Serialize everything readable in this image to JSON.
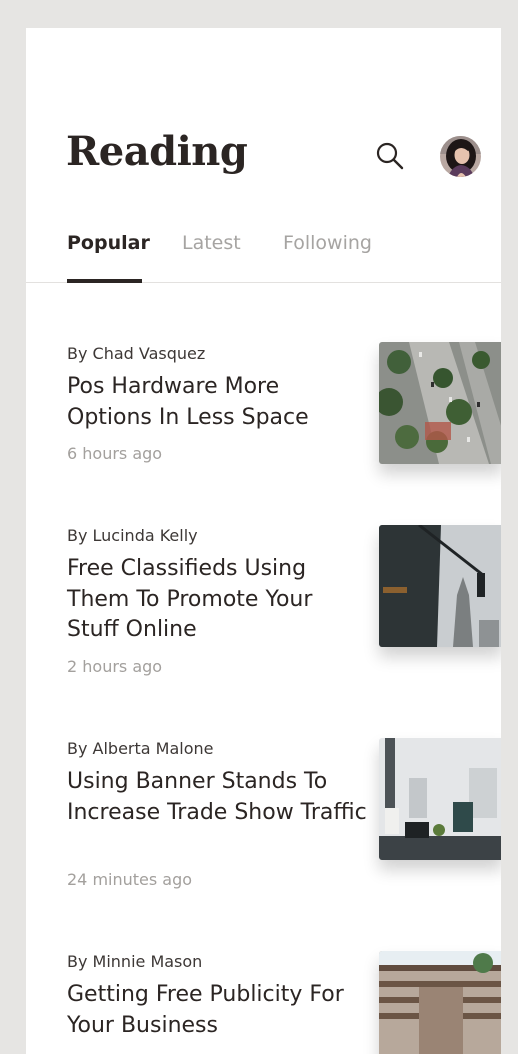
{
  "header": {
    "title": "Reading"
  },
  "tabs": [
    {
      "label": "Popular",
      "active": true
    },
    {
      "label": "Latest",
      "active": false
    },
    {
      "label": "Following",
      "active": false
    }
  ],
  "articles": [
    {
      "author": "By Chad Vasquez",
      "headline": "Pos Hardware More Options In Less Space",
      "time": "6 hours ago",
      "image": "aerial-city-street"
    },
    {
      "author": "By Lucinda Kelly",
      "headline": "Free Classifieds Using Them To Promote Your Stuff Online",
      "time": "2 hours ago",
      "image": "skyscraper-traffic-light"
    },
    {
      "author": "By Alberta Malone",
      "headline": "Using Banner Stands To Increase Trade Show Traffic",
      "time": "24 minutes ago",
      "image": "office-desk"
    },
    {
      "author": "By Minnie Mason",
      "headline": "Getting Free Publicity For Your Business",
      "time": "",
      "image": "shopping-mall"
    }
  ],
  "colors": {
    "background": "#e6e5e3",
    "card": "#ffffff",
    "text_primary": "#2b2523",
    "text_muted": "#a3a09d",
    "active_tab_indicator": "#2b2523"
  }
}
